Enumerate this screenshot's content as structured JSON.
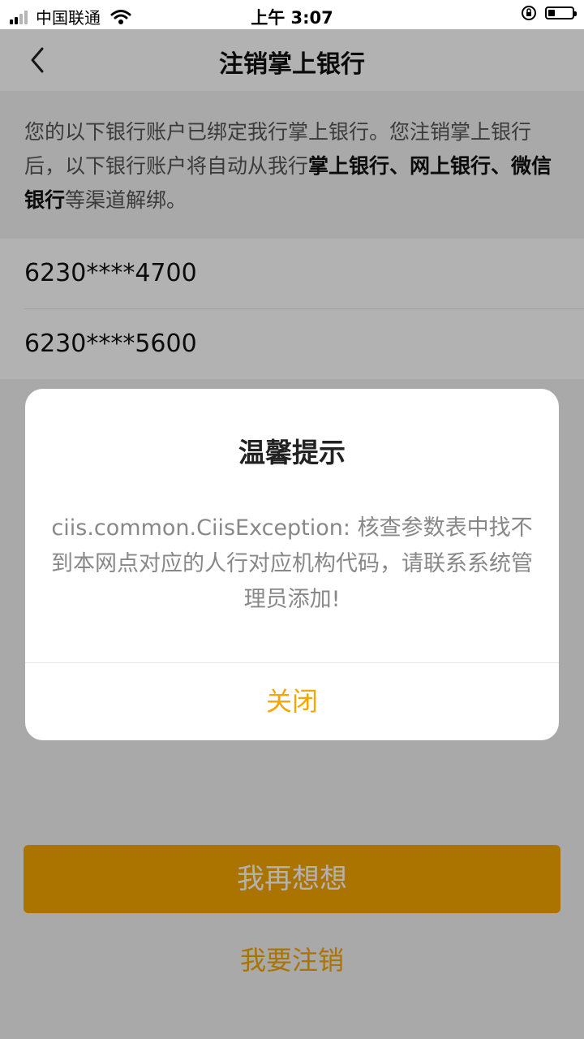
{
  "status_bar": {
    "carrier": "中国联通",
    "time": "上午 3:07"
  },
  "nav": {
    "title": "注销掌上银行"
  },
  "notice": {
    "text_start": "您的以下银行账户已绑定我行掌上银行。您注销掌上银行后，以下银行账户将自动从我行",
    "bold": "掌上银行、网上银行、微信银行",
    "text_end": "等渠道解绑。"
  },
  "accounts": [
    {
      "number": "6230****4700"
    },
    {
      "number": "6230****5600"
    }
  ],
  "buttons": {
    "primary": "我再想想",
    "secondary": "我要注销"
  },
  "dialog": {
    "title": "温馨提示",
    "message": "ciis.common.CiisException: 核查参数表中找不到本网点对应的人行对应机构代码，请联系系统管理员添加!",
    "close_label": "关闭"
  },
  "colors": {
    "accent": "#f5a600"
  }
}
